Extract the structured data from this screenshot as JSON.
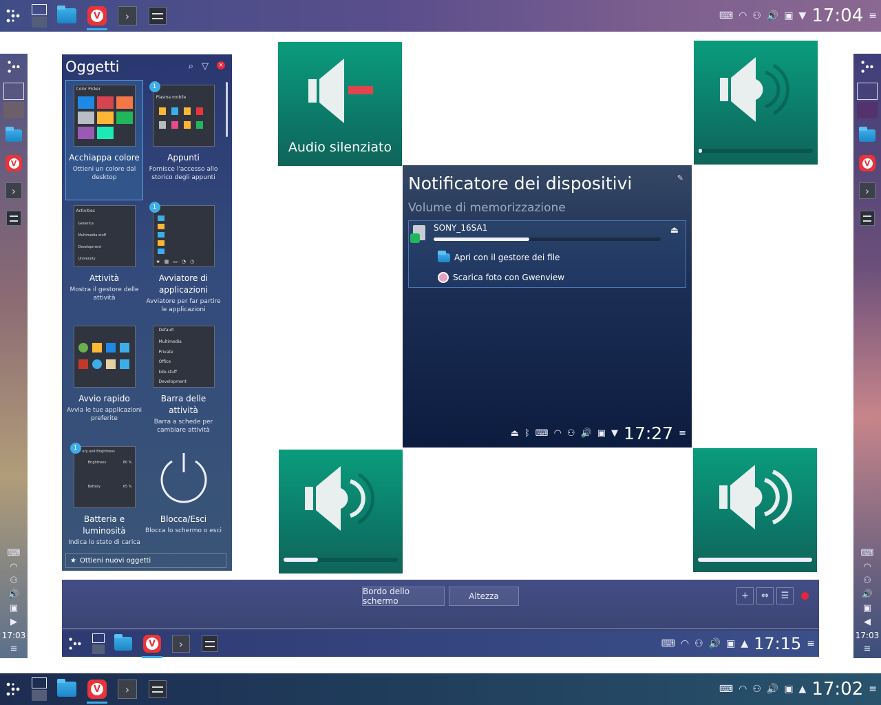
{
  "panels": {
    "top_clock": "17:04",
    "bottom_clock": "17:02",
    "left_clock": "17:03",
    "right_clock": "17:03",
    "editor_clock": "17:15",
    "menu_glyph": "≡"
  },
  "icons": {
    "launcher": "kicker-icon",
    "tray": [
      "keyboard-icon",
      "wifi-icon",
      "user-icon",
      "volume-icon",
      "battery-icon"
    ],
    "accent": "#3daee9"
  },
  "widgets": {
    "title": "Oggetti",
    "items": [
      {
        "title": "Acchiappa colore",
        "desc": "Ottieni un colore dal desktop",
        "thumb_title": "Color Picker",
        "badge": ""
      },
      {
        "title": "Appunti",
        "desc": "Fornisce l'accesso allo storico degli appunti",
        "thumb_title": "Plasma mobile",
        "badge": "1"
      },
      {
        "title": "Attività",
        "desc": "Mostra il gestore delle attività",
        "thumb_title": "Activities",
        "badge": ""
      },
      {
        "title": "Avviatore di applicazioni",
        "desc": "Avviatore per far partire le applicazioni",
        "thumb_title": "",
        "badge": "1"
      },
      {
        "title": "Avvio rapido",
        "desc": "Avvia le tue applicazioni preferite",
        "thumb_title": "",
        "badge": ""
      },
      {
        "title": "Barra delle attività",
        "desc": "Barra a schede per cambiare attività",
        "thumb_title": "Default",
        "badge": ""
      },
      {
        "title": "Batteria e luminosità",
        "desc": "Indica lo stato di carica",
        "thumb_title": "ery and Brightness",
        "badge": "1"
      },
      {
        "title": "Blocca/Esci",
        "desc": "Blocca lo schermo o esci",
        "thumb_title": "",
        "badge": ""
      }
    ],
    "activities_list": [
      "Generica",
      "Multimedia stuff",
      "Development",
      "University"
    ],
    "taskbar_list": [
      "Multimedia",
      "Private",
      "Office",
      "kde-stuff",
      "Development"
    ],
    "battery_rows": [
      {
        "label": "Brightness",
        "value": "80 %"
      },
      {
        "label": "Battery",
        "value": "65 %"
      }
    ],
    "get_new": "Ottieni nuovi oggetti"
  },
  "osd": {
    "muted_label": "Audio silenziato",
    "levels": [
      0.03,
      0.3,
      1.0
    ]
  },
  "device_notifier": {
    "title": "Notificatore dei dispositivi",
    "subtitle": "Volume di memorizzazione",
    "device": "SONY_16SA1",
    "usage": 0.42,
    "actions": [
      "Apri con il gestore dei file",
      "Scarica foto con Gwenview"
    ],
    "clock": "17:27"
  },
  "editor": {
    "screen_edge": "Bordo dello schermo",
    "height": "Altezza"
  }
}
